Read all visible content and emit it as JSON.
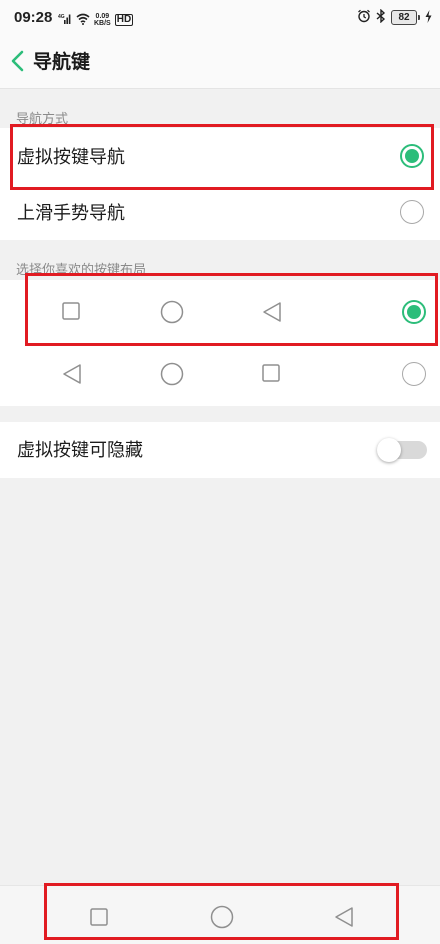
{
  "status_bar": {
    "time": "09:28",
    "network_speed_value": "0.09",
    "network_speed_unit": "KB/S",
    "hd_label": "HD",
    "battery_level": "82",
    "icons": [
      "signal-icon",
      "wifi-icon",
      "alarm-icon",
      "bluetooth-icon",
      "battery-icon",
      "charging-icon"
    ]
  },
  "header": {
    "title": "导航键",
    "back_icon": "chevron-left-icon"
  },
  "navigation_mode": {
    "section_label": "导航方式",
    "options": [
      {
        "label": "虚拟按键导航",
        "selected": true
      },
      {
        "label": "上滑手势导航",
        "selected": false
      }
    ]
  },
  "button_layout": {
    "section_label": "选择你喜欢的按键布局",
    "layouts": [
      {
        "buttons": [
          "square-icon",
          "circle-icon",
          "triangle-left-icon"
        ],
        "selected": true
      },
      {
        "buttons": [
          "triangle-left-icon",
          "circle-icon",
          "square-icon"
        ],
        "selected": false
      }
    ]
  },
  "hide_keys": {
    "label": "虚拟按键可隐藏",
    "enabled": false
  },
  "bottom_nav": {
    "buttons": [
      "recent-apps-icon",
      "home-icon",
      "back-icon"
    ]
  },
  "colors": {
    "accent": "#2cbd7a",
    "highlight_box": "#e11b22",
    "background": "#f1f1f1",
    "card": "#ffffff"
  }
}
